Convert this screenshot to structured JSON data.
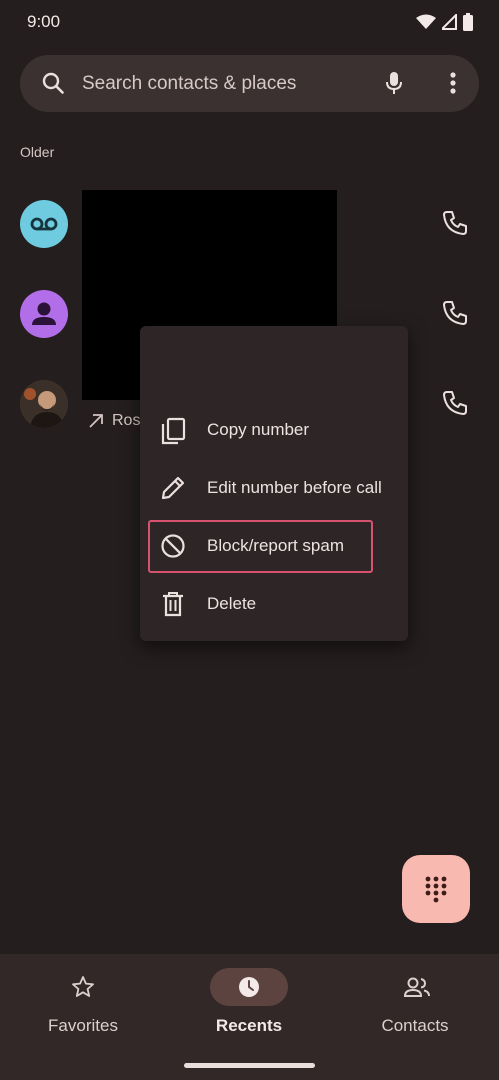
{
  "status": {
    "time": "9:00"
  },
  "search": {
    "placeholder": "Search contacts & places"
  },
  "section": {
    "label": "Older"
  },
  "rows": [
    {
      "avatar": "voicemail-avatar",
      "name": "",
      "detail": ""
    },
    {
      "avatar": "person-avatar",
      "name": "",
      "detail": ""
    },
    {
      "avatar": "photo-avatar",
      "name": "",
      "detail": "Ros"
    }
  ],
  "menu": {
    "items": [
      {
        "label": "Copy number",
        "icon": "copy-icon"
      },
      {
        "label": "Edit number before call",
        "icon": "pencil-icon"
      },
      {
        "label": "Block/report spam",
        "icon": "block-icon"
      },
      {
        "label": "Delete",
        "icon": "trash-icon"
      }
    ]
  },
  "nav": {
    "items": [
      {
        "label": "Favorites",
        "icon": "star-icon",
        "active": false
      },
      {
        "label": "Recents",
        "icon": "clock-icon",
        "active": true
      },
      {
        "label": "Contacts",
        "icon": "people-icon",
        "active": false
      }
    ]
  },
  "colors": {
    "background": "#241e1e",
    "fab": "#f8b9b0",
    "highlight": "#d6526f",
    "voicemail_avatar": "#6fcbe0",
    "person_avatar": "#b26ee8"
  }
}
